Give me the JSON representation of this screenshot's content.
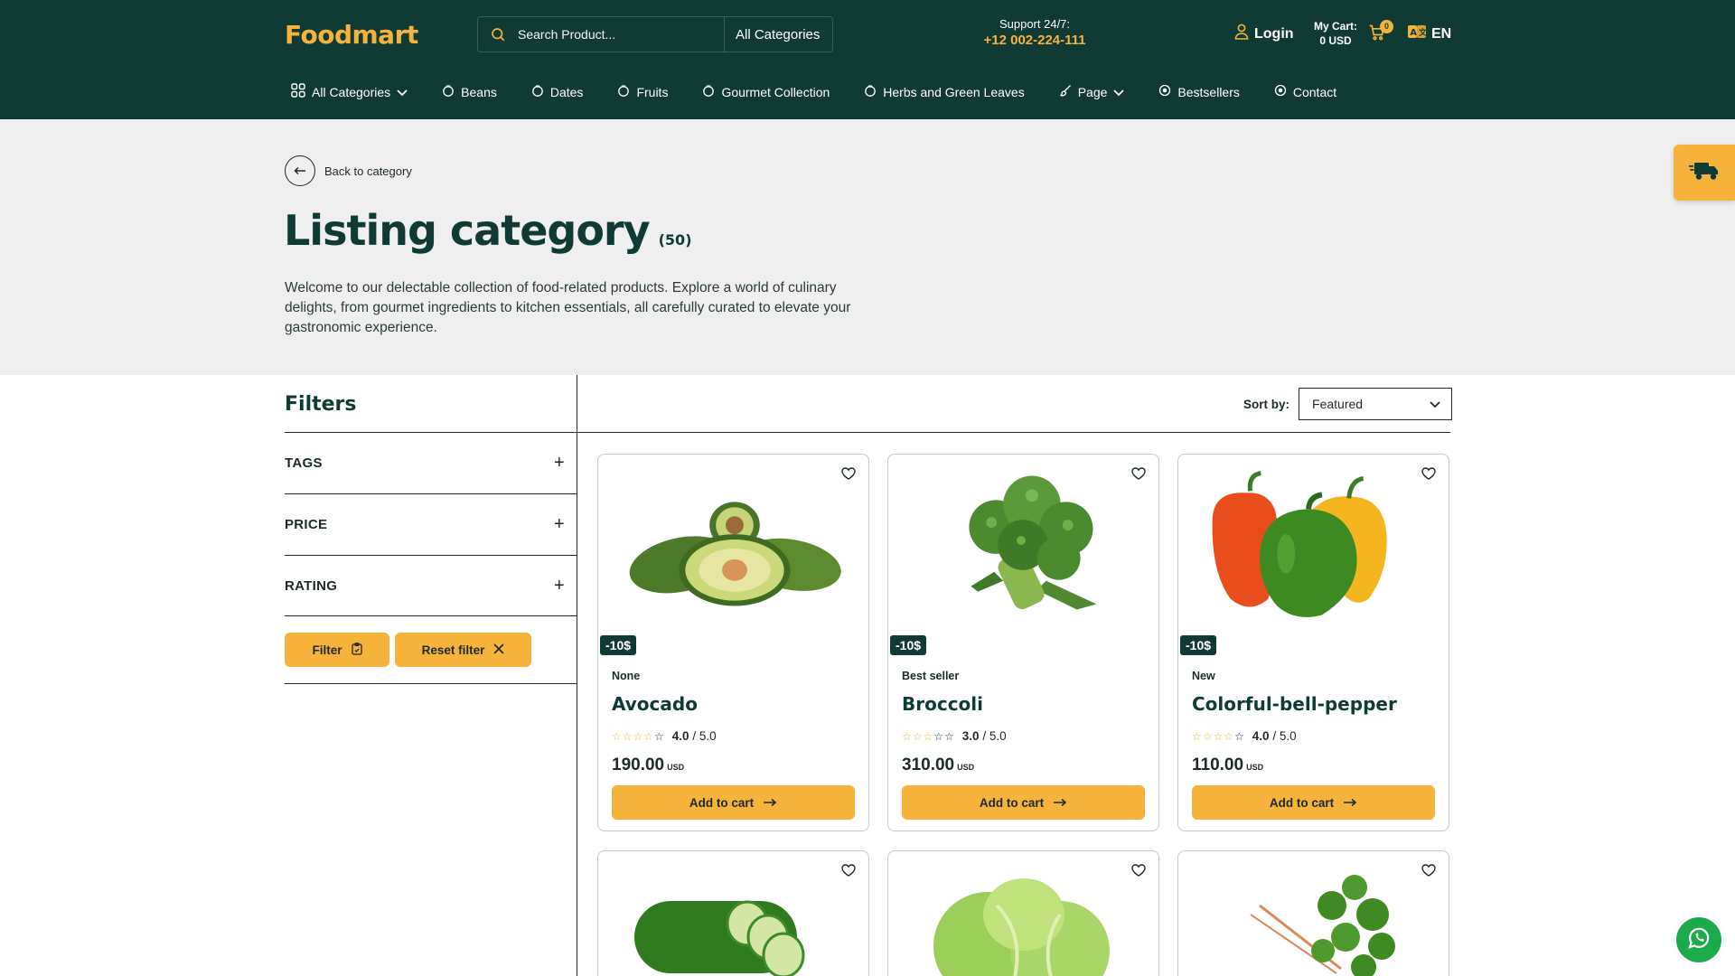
{
  "header": {
    "logo": "Foodmart",
    "search": {
      "placeholder": "Search Product...",
      "category": "All Categories"
    },
    "support": {
      "label": "Support 24/7:",
      "phone": "+12 002-224-111"
    },
    "login": "Login",
    "cart": {
      "label": "My Cart:",
      "amount": "0 USD",
      "count": "0"
    },
    "language": "EN"
  },
  "nav": {
    "items": [
      {
        "label": "All Categories"
      },
      {
        "label": "Beans"
      },
      {
        "label": "Dates"
      },
      {
        "label": "Fruits"
      },
      {
        "label": "Gourmet Collection"
      },
      {
        "label": "Herbs and Green Leaves"
      },
      {
        "label": "Page"
      },
      {
        "label": "Bestsellers"
      },
      {
        "label": "Contact"
      }
    ]
  },
  "hero": {
    "back": "Back to category",
    "title": "Listing category",
    "count": "(50)",
    "description": "Welcome to our delectable collection of food-related products. Explore a world of culinary delights, from gourmet ingredients to kitchen essentials, all carefully curated to elevate your gastronomic experience."
  },
  "filters": {
    "title": "Filters",
    "groups": [
      {
        "label": "TAGS"
      },
      {
        "label": "PRICE"
      },
      {
        "label": "RATING"
      }
    ],
    "filter_button": "Filter",
    "reset_button": "Reset filter"
  },
  "sort": {
    "label": "Sort by:",
    "value": "Featured"
  },
  "products": [
    {
      "name": "Avocado",
      "tag": "None",
      "badge": "-10$",
      "rating": "4.0",
      "rating_max": "/ 5.0",
      "rating_value": 4,
      "price": "190.00",
      "currency": "USD",
      "cta": "Add to cart"
    },
    {
      "name": "Broccoli",
      "tag": "Best seller",
      "badge": "-10$",
      "rating": "3.0",
      "rating_max": "/ 5.0",
      "rating_value": 3,
      "price": "310.00",
      "currency": "USD",
      "cta": "Add to cart"
    },
    {
      "name": "Colorful-bell-pepper",
      "tag": "New",
      "badge": "-10$",
      "rating": "4.0",
      "rating_max": "/ 5.0",
      "rating_value": 4,
      "price": "110.00",
      "currency": "USD",
      "cta": "Add to cart"
    }
  ],
  "colors": {
    "primary": "#103b35",
    "accent": "#f6b33c",
    "hero_bg": "#efefef",
    "whatsapp": "#1bab4a"
  },
  "icons": [
    "search-icon",
    "user-icon",
    "cart-icon",
    "translate-icon",
    "grid-icon",
    "bag-icon",
    "brush-icon",
    "chevron-down-icon",
    "arrow-left-icon",
    "delivery-truck-icon",
    "heart-icon",
    "clipboard-icon",
    "close-icon",
    "arrow-right-icon",
    "whatsapp-icon"
  ]
}
